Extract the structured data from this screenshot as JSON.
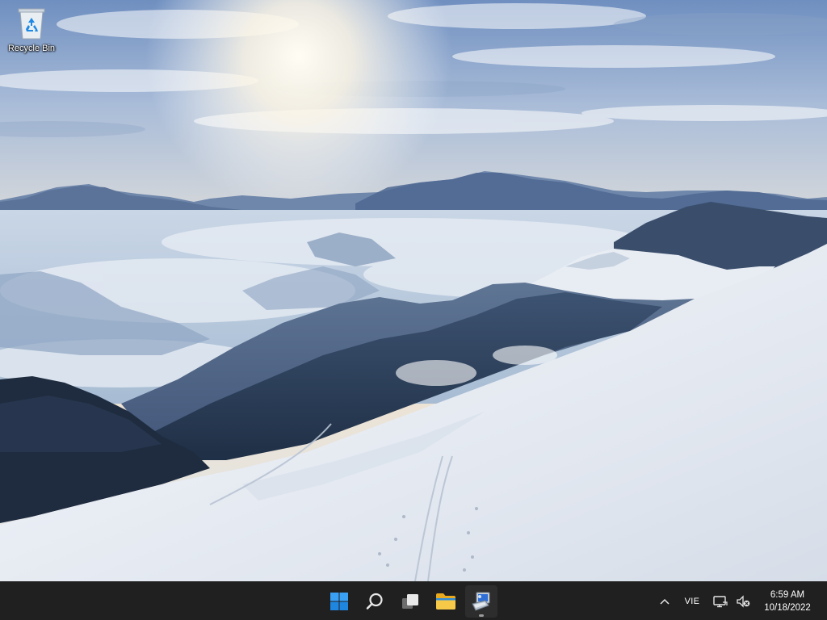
{
  "desktop": {
    "icons": [
      {
        "label": "Recycle Bin",
        "icon": "recycle-bin-icon"
      }
    ]
  },
  "taskbar": {
    "pinned": [
      {
        "name": "Start",
        "icon": "windows-logo-icon",
        "active": false
      },
      {
        "name": "Search",
        "icon": "search-icon",
        "active": false
      },
      {
        "name": "Task View",
        "icon": "task-view-icon",
        "active": false
      },
      {
        "name": "File Explorer",
        "icon": "folder-icon",
        "active": false
      },
      {
        "name": "Installer",
        "icon": "installer-icon",
        "active": true
      }
    ],
    "tray": {
      "chevron_icon": "chevron-up-icon",
      "language": "VIE",
      "network_icon": "network-icon",
      "volume_icon": "volume-muted-icon",
      "time": "6:59 AM",
      "date": "10/18/2022"
    }
  },
  "colors": {
    "taskbar_bg": "#202020",
    "windows_blue": "#0078d4",
    "folder_yellow": "#f3c13a"
  }
}
